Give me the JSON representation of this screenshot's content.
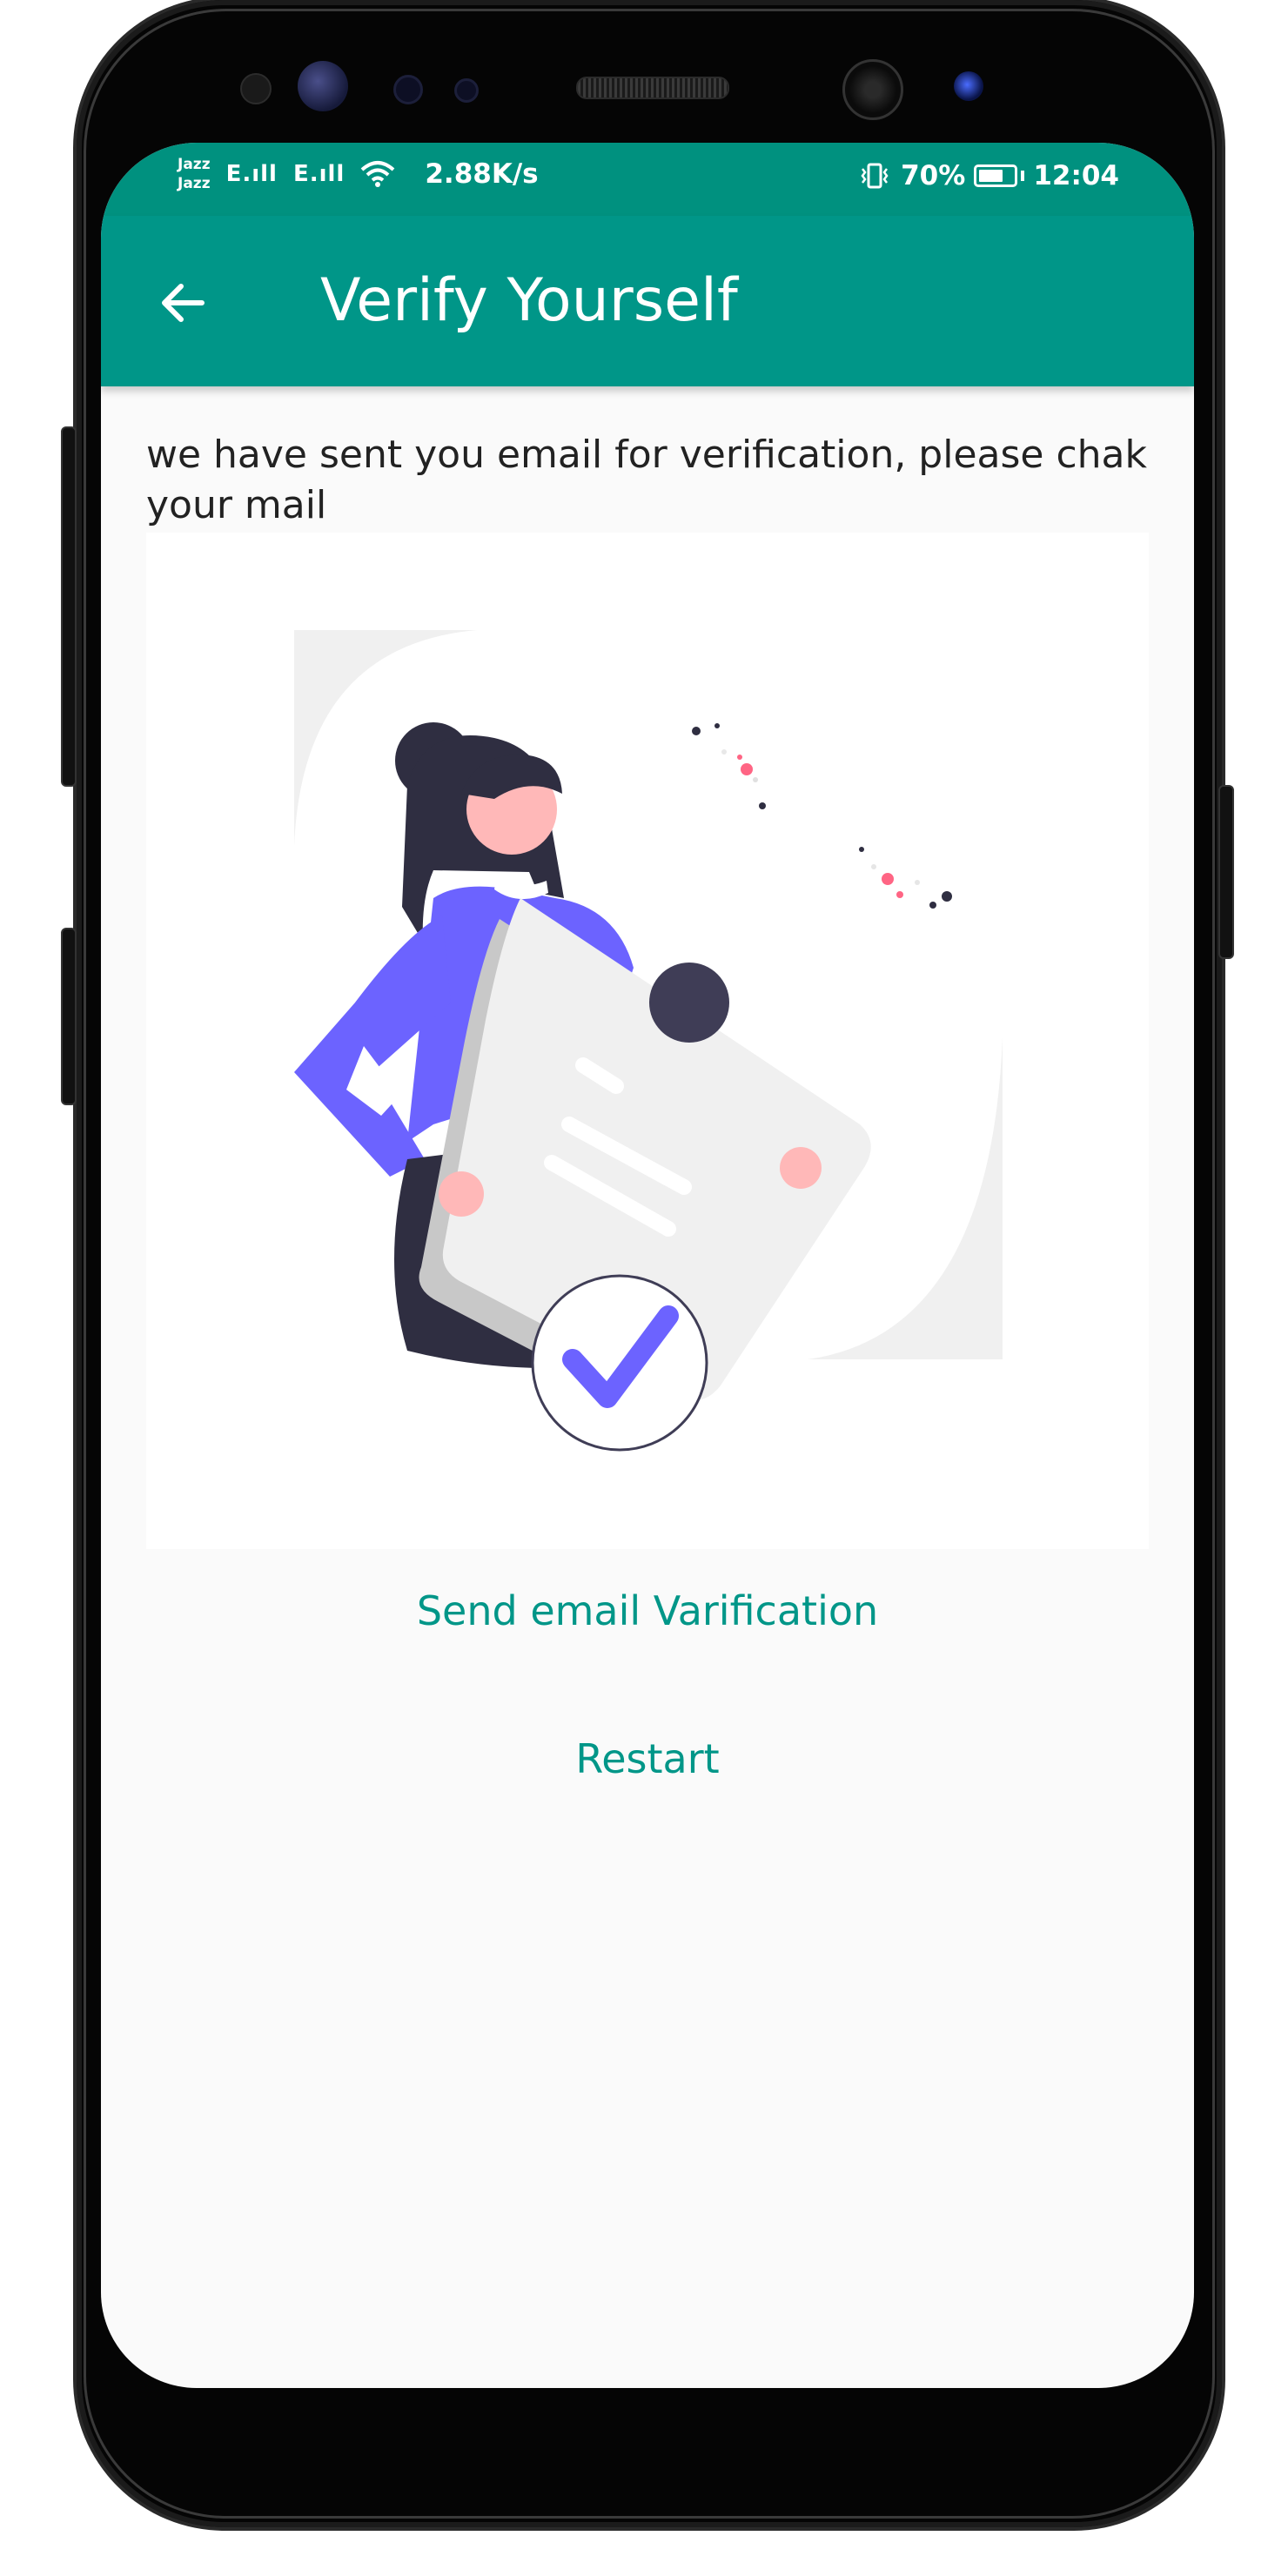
{
  "status_bar": {
    "carrier_1": "Jazz",
    "carrier_2": "Jazz",
    "signal_1": "E.ıll",
    "signal_2": "E.ıll",
    "network_speed": "2.88K/s",
    "vibrate_icon": "vibrate-icon",
    "battery_percent": "70%",
    "battery_level": 0.7,
    "time": "12:04"
  },
  "app_bar": {
    "title": "Verify Yourself",
    "back_icon": "arrow-left-icon"
  },
  "content": {
    "message": "we have sent you email for verification, please chak your mail",
    "illustration": "woman-holding-document-with-checkmark"
  },
  "actions": {
    "send_label": "Send email Varification",
    "restart_label": "Restart"
  },
  "colors": {
    "primary": "#009688",
    "status_bar": "#00917f",
    "illustration_accent": "#6c63ff",
    "illustration_dark": "#2f2e41",
    "illustration_skin": "#ffb8b8"
  }
}
